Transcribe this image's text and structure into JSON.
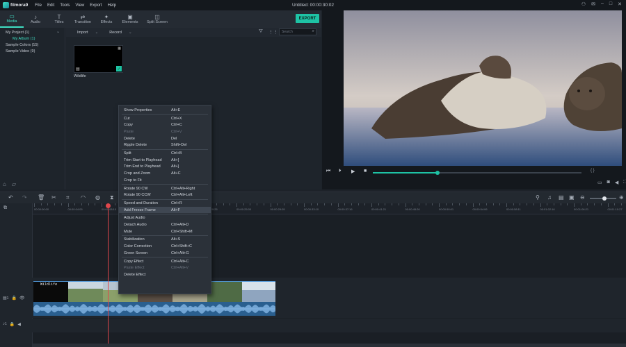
{
  "app": {
    "logo_text": "filmora9",
    "window_title": "Untitled: 00:00:30:02"
  },
  "menu": [
    "File",
    "Edit",
    "Tools",
    "View",
    "Export",
    "Help"
  ],
  "media_tabs": [
    {
      "label": "Media",
      "icon": "folder-icon",
      "glyph": "▭"
    },
    {
      "label": "Audio",
      "icon": "music-note-icon",
      "glyph": "♪"
    },
    {
      "label": "Titles",
      "icon": "text-icon",
      "glyph": "T"
    },
    {
      "label": "Transition",
      "icon": "transition-icon",
      "glyph": "⇄"
    },
    {
      "label": "Effects",
      "icon": "effects-icon",
      "glyph": "✦"
    },
    {
      "label": "Elements",
      "icon": "elements-icon",
      "glyph": "▣"
    },
    {
      "label": "Split Screen",
      "icon": "split-screen-icon",
      "glyph": "◫"
    }
  ],
  "export_label": "EXPORT",
  "library": {
    "items": [
      {
        "label": "My Project (1)",
        "sub": false
      },
      {
        "label": "My Album (1)",
        "sub": true
      },
      {
        "label": "Sample Colors (15)",
        "sub": false
      },
      {
        "label": "Sample Video (9)",
        "sub": false
      }
    ]
  },
  "media_bar": {
    "import_label": "Import",
    "record_label": "Record",
    "search_placeholder": "Search"
  },
  "media_items": [
    {
      "label": "Wildlife"
    }
  ],
  "timeline": {
    "ruler": [
      "00:00:00:00",
      "00:00:04:05",
      "00:00:08:10",
      "00:00:12:15",
      "00:00:16:20",
      "00:00:20:25",
      "00:00:25:00",
      "00:00:29:05",
      "00:00:33:10",
      "00:00:37:16",
      "00:00:41:21",
      "00:00:45:26",
      "00:00:50:01",
      "00:00:54:06",
      "00:00:58:11",
      "00:01:02:16",
      "00:01:06:21",
      "00:01:10:27"
    ],
    "clip_title": "Wildlife",
    "track_video_num": "1",
    "track_audio_num": "1",
    "zoom_level": 0.55
  },
  "preview": {
    "progress": 0.31
  },
  "context_menu": [
    {
      "label": "Show Properties",
      "shortcut": "Alt+E",
      "disabled": false
    },
    {
      "sep": true
    },
    {
      "label": "Cut",
      "shortcut": "Ctrl+X",
      "disabled": false
    },
    {
      "label": "Copy",
      "shortcut": "Ctrl+C",
      "disabled": false
    },
    {
      "label": "Paste",
      "shortcut": "Ctrl+V",
      "disabled": true
    },
    {
      "label": "Delete",
      "shortcut": "Del",
      "disabled": false
    },
    {
      "label": "Ripple Delete",
      "shortcut": "Shift+Del",
      "disabled": false
    },
    {
      "sep": true
    },
    {
      "label": "Split",
      "shortcut": "Ctrl+B",
      "disabled": false
    },
    {
      "label": "Trim Start to Playhead",
      "shortcut": "Alt+[",
      "disabled": false
    },
    {
      "label": "Trim End to Playhead",
      "shortcut": "Alt+]",
      "disabled": false
    },
    {
      "label": "Crop and Zoom",
      "shortcut": "Alt+C",
      "disabled": false
    },
    {
      "label": "Crop to Fit",
      "shortcut": "",
      "disabled": false
    },
    {
      "sep": true
    },
    {
      "label": "Rotate 90 CW",
      "shortcut": "Ctrl+Alt+Right",
      "disabled": false
    },
    {
      "label": "Rotate 90 CCW",
      "shortcut": "Ctrl+Alt+Left",
      "disabled": false
    },
    {
      "sep": true
    },
    {
      "label": "Speed and Duration",
      "shortcut": "Ctrl+R",
      "disabled": false
    },
    {
      "label": "Add Freeze Frame",
      "shortcut": "Alt+F",
      "disabled": false,
      "highlight": true
    },
    {
      "sep": true
    },
    {
      "label": "Adjust Audio",
      "shortcut": "",
      "disabled": false
    },
    {
      "label": "Detach Audio",
      "shortcut": "Ctrl+Alt+D",
      "disabled": false
    },
    {
      "label": "Mute",
      "shortcut": "Ctrl+Shift+M",
      "disabled": false
    },
    {
      "sep": true
    },
    {
      "label": "Stabilization",
      "shortcut": "Alt+S",
      "disabled": false
    },
    {
      "label": "Color Correction",
      "shortcut": "Ctrl+Shift+C",
      "disabled": false
    },
    {
      "label": "Green Screen",
      "shortcut": "Ctrl+Alt+G",
      "disabled": false
    },
    {
      "sep": true
    },
    {
      "label": "Copy Effect",
      "shortcut": "Ctrl+Alt+C",
      "disabled": false
    },
    {
      "label": "Paste Effect",
      "shortcut": "Ctrl+Alt+V",
      "disabled": true
    },
    {
      "label": "Delete Effect",
      "shortcut": "",
      "disabled": false
    }
  ],
  "colors": {
    "accent": "#1ec3a5",
    "playhead": "#e0474c",
    "audio_clip": "#2a5f8f"
  }
}
